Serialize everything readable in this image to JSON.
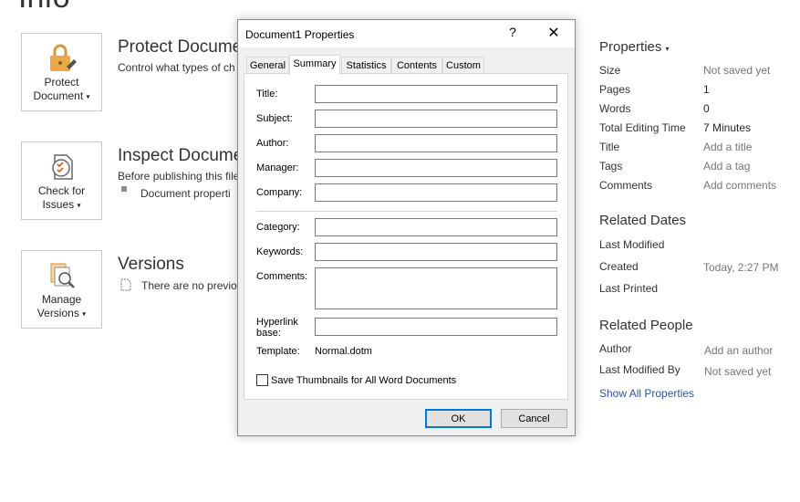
{
  "page": {
    "title": "Info"
  },
  "sections": {
    "protect": {
      "button_label_1": "Protect",
      "button_label_2": "Document",
      "title": "Protect Docume",
      "desc": "Control what types of ch"
    },
    "inspect": {
      "button_label_1": "Check for",
      "button_label_2": "Issues",
      "title": "Inspect Docume",
      "desc": "Before publishing this file",
      "bullet": "Document properti"
    },
    "versions": {
      "button_label_1": "Manage",
      "button_label_2": "Versions",
      "title": "Versions",
      "desc": "There are no previou"
    }
  },
  "properties": {
    "heading": "Properties",
    "rows": [
      {
        "label": "Size",
        "value": "Not saved yet"
      },
      {
        "label": "Pages",
        "value": "1"
      },
      {
        "label": "Words",
        "value": "0"
      },
      {
        "label": "Total Editing Time",
        "value": "7 Minutes"
      },
      {
        "label": "Title",
        "value": "Add a title"
      },
      {
        "label": "Tags",
        "value": "Add a tag"
      },
      {
        "label": "Comments",
        "value": "Add comments"
      }
    ]
  },
  "related_dates": {
    "heading": "Related Dates",
    "rows": [
      {
        "label": "Last Modified",
        "value": ""
      },
      {
        "label": "Created",
        "value": "Today, 2:27 PM"
      },
      {
        "label": "Last Printed",
        "value": ""
      }
    ]
  },
  "related_people": {
    "heading": "Related People",
    "rows": [
      {
        "label": "Author",
        "value": "Add an author"
      },
      {
        "label": "Last Modified By",
        "value": "Not saved yet"
      }
    ],
    "show_all": "Show All Properties"
  },
  "dialog": {
    "title": "Document1 Properties",
    "help": "?",
    "close": "✕",
    "tabs": [
      "General",
      "Summary",
      "Statistics",
      "Contents",
      "Custom"
    ],
    "active_tab": "Summary",
    "fields": {
      "title": {
        "label": "Title:",
        "value": ""
      },
      "subject": {
        "label": "Subject:",
        "value": ""
      },
      "author": {
        "label": "Author:",
        "value": ""
      },
      "manager": {
        "label": "Manager:",
        "value": ""
      },
      "company": {
        "label": "Company:",
        "value": ""
      },
      "category": {
        "label": "Category:",
        "value": ""
      },
      "keywords": {
        "label": "Keywords:",
        "value": ""
      },
      "comments": {
        "label": "Comments:",
        "value": ""
      },
      "hyperlink_1": "Hyperlink",
      "hyperlink_2": "base:",
      "hyperlink_value": "",
      "template_label": "Template:",
      "template_value": "Normal.dotm"
    },
    "save_thumbnails": "Save Thumbnails for All Word Documents",
    "ok": "OK",
    "cancel": "Cancel"
  }
}
